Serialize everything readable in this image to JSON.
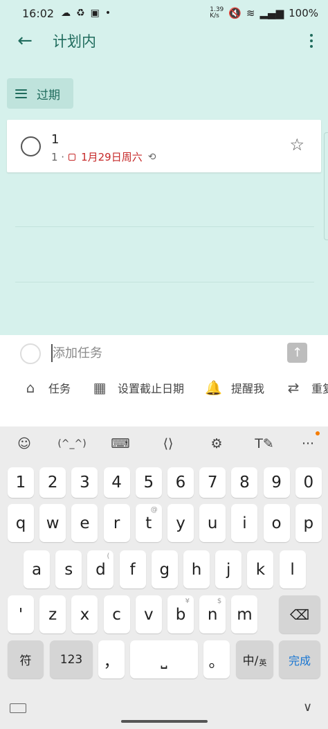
{
  "status_bar": {
    "time": "16:02",
    "left_icons": [
      "weather-icon",
      "recycle-icon",
      "shopping-bag-icon",
      "dot-icon"
    ],
    "speed": "1.39 K/s",
    "battery": "100%"
  },
  "app_bar": {
    "title": "计划内",
    "back_icon": "arrow-left-icon",
    "more_icon": "more-vertical-icon"
  },
  "section": {
    "label": "过期"
  },
  "tasks": [
    {
      "title": "1",
      "count": "1 ·",
      "due": "1月29日周六",
      "due_color": "#c62828",
      "repeat_icon": "repeat-icon",
      "star_icon": "star-outline-icon"
    }
  ],
  "add_task": {
    "placeholder": "添加任务",
    "value": ""
  },
  "actions": [
    {
      "label": "任务",
      "icon": "house-check-icon"
    },
    {
      "label": "设置截止日期",
      "icon": "calendar-icon"
    },
    {
      "label": "提醒我",
      "icon": "bell-icon"
    },
    {
      "label": "重复",
      "icon": "repeat-icon"
    }
  ],
  "keyboard": {
    "tools": [
      "emoji-icon",
      "(^_^)",
      "keyboard-icon",
      "cursor-move-icon",
      "gear-icon",
      "handwriting-icon",
      "more-horizontal-icon"
    ],
    "kaomoji": "(^_^)",
    "numbers": [
      "1",
      "2",
      "3",
      "4",
      "5",
      "6",
      "7",
      "8",
      "9",
      "0"
    ],
    "row1": [
      "q",
      "w",
      "e",
      "r",
      "t",
      "y",
      "u",
      "i",
      "o",
      "p"
    ],
    "row1_hints": [
      "",
      "",
      "",
      "",
      "@",
      "",
      "",
      "",
      "",
      ""
    ],
    "row2": [
      "a",
      "s",
      "d",
      "f",
      "g",
      "h",
      "j",
      "k",
      "l"
    ],
    "row2_hints": [
      "",
      "",
      "(",
      "",
      "",
      "",
      "",
      "",
      ""
    ],
    "row3": [
      "'",
      "z",
      "x",
      "c",
      "v",
      "b",
      "n",
      "m"
    ],
    "row3_hints": [
      "",
      "",
      "",
      "",
      "",
      "¥",
      "$",
      ""
    ],
    "symbol_key": "符",
    "num_key": "123",
    "comma_key": "，",
    "space_key": "⎵",
    "period_key": "。",
    "lang_key": "中/",
    "lang_key_sub": "英",
    "done_key": "完成",
    "accent_color": "#1976d2"
  }
}
